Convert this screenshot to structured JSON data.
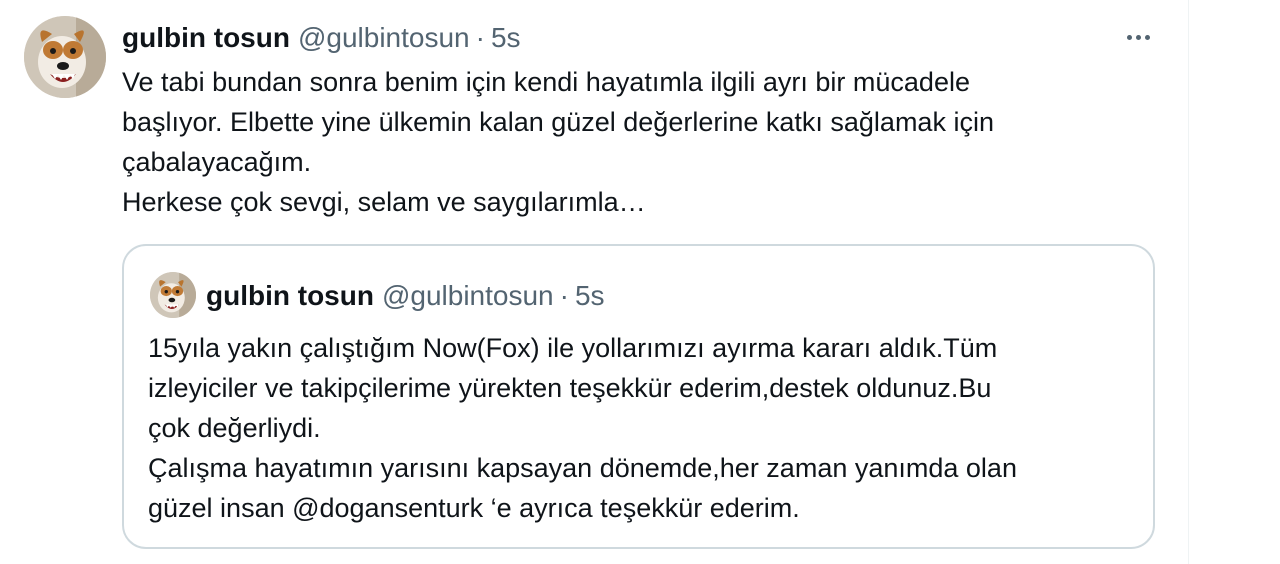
{
  "tweet": {
    "author_name": "gulbin tosun",
    "author_handle": "@gulbintosun",
    "separator": "·",
    "time": "5s",
    "more_icon": "more-horizontal-icon",
    "text_lines": [
      "Ve tabi bundan sonra benim için kendi hayatımla ilgili ayrı bir mücadele",
      "başlıyor. Elbette yine  ülkemin kalan güzel değerlerine katkı sağlamak için",
      "çabalayacağım.",
      "Herkese çok sevgi, selam ve saygılarımla…"
    ]
  },
  "quote": {
    "author_name": "gulbin tosun",
    "author_handle": "@gulbintosun",
    "separator": "·",
    "time": "5s",
    "text_lines": [
      "15yıla yakın çalıştığım Now(Fox) ile yollarımızı ayırma kararı aldık.Tüm",
      "izleyiciler ve takipçilerime yürekten teşekkür ederim,destek oldunuz.Bu",
      "çok değerliydi.",
      "Çalışma hayatımın yarısını kapsayan dönemde,her zaman yanımda olan",
      "güzel insan @dogansenturk ‘e ayrıca teşekkür ederim."
    ]
  },
  "colors": {
    "text_primary": "#0f1419",
    "text_secondary": "#536471",
    "quote_border": "#cfd9de"
  }
}
